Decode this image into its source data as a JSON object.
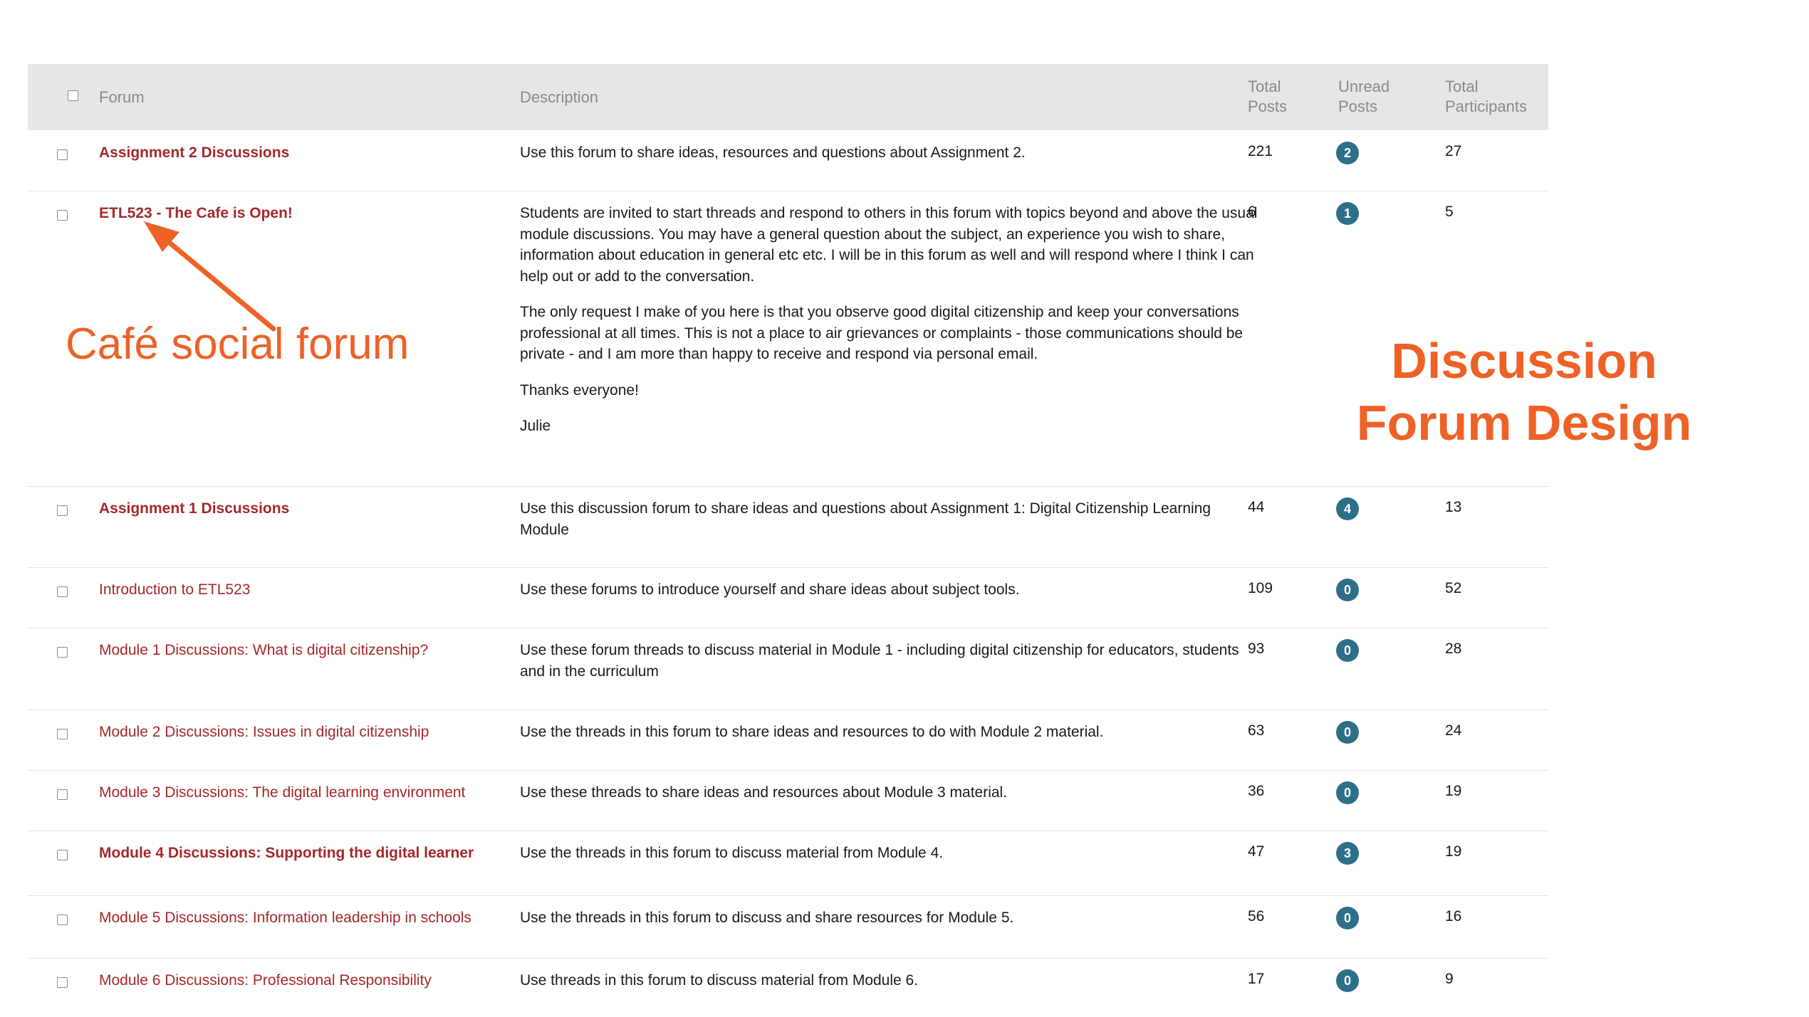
{
  "header": {
    "forum": "Forum",
    "description": "Description",
    "total_posts": "Total\nPosts",
    "unread_posts": "Unread\nPosts",
    "total_participants": "Total\nParticipants"
  },
  "rows": [
    {
      "forum": "Assignment 2 Discussions",
      "bold": true,
      "description": [
        "Use this forum to share ideas, resources and questions about Assignment 2."
      ],
      "total_posts": "221",
      "unread": "2",
      "participants": "27"
    },
    {
      "forum": "ETL523 - The Cafe is Open!",
      "bold": true,
      "description": [
        "Students are invited to start threads and respond to others in this forum with topics beyond and above the usual module discussions. You may have a general question about the subject, an experience you wish to share, information about education in general etc etc. I will be in this forum as well and will respond where I think I can help out or add to the conversation.",
        "The only request I make of you here is that you observe good digital citizenship and keep your conversations professional at all times. This is not a place to air grievances or complaints - those communications should be private - and I am more than happy to receive and respond via personal email.",
        "Thanks everyone!",
        "Julie"
      ],
      "total_posts": "6",
      "unread": "1",
      "participants": "5"
    },
    {
      "forum": "Assignment 1 Discussions",
      "bold": true,
      "description": [
        "Use this discussion forum to share ideas and questions about Assignment 1: Digital Citizenship Learning Module"
      ],
      "total_posts": "44",
      "unread": "4",
      "participants": "13"
    },
    {
      "forum": "Introduction to ETL523",
      "bold": false,
      "description": [
        "Use these forums to introduce yourself and share ideas about subject tools."
      ],
      "total_posts": "109",
      "unread": "0",
      "participants": "52"
    },
    {
      "forum": "Module 1 Discussions: What is digital citizenship?",
      "bold": false,
      "description": [
        "Use these forum threads to discuss material in Module 1 - including digital citizenship for educators, students and in the curriculum"
      ],
      "total_posts": "93",
      "unread": "0",
      "participants": "28"
    },
    {
      "forum": "Module 2 Discussions: Issues in digital citizenship",
      "bold": false,
      "description": [
        "Use the threads in this forum to share ideas and resources to do with Module 2 material."
      ],
      "total_posts": "63",
      "unread": "0",
      "participants": "24"
    },
    {
      "forum": "Module 3 Discussions: The digital learning environment",
      "bold": false,
      "description": [
        "Use these threads to share ideas and resources about Module 3 material."
      ],
      "total_posts": "36",
      "unread": "0",
      "participants": "19"
    },
    {
      "forum": "Module 4 Discussions: Supporting the digital learner",
      "bold": true,
      "description": [
        "Use the threads in this forum to discuss material from Module 4."
      ],
      "total_posts": "47",
      "unread": "3",
      "participants": "19"
    },
    {
      "forum": "Module 5 Discussions: Information leadership in schools",
      "bold": false,
      "description": [
        "Use the threads in this forum to discuss and share resources for Module 5."
      ],
      "total_posts": "56",
      "unread": "0",
      "participants": "16"
    },
    {
      "forum": "Module 6 Discussions: Professional Responsibility",
      "bold": false,
      "description": [
        "Use threads in this forum to discuss material from Module 6."
      ],
      "total_posts": "17",
      "unread": "0",
      "participants": "9"
    }
  ],
  "annotations": {
    "cafe_label": "Café social forum",
    "design_title": "Discussion\nForum Design",
    "accent_color": "#ee6227"
  },
  "colors": {
    "forum_link": "#a5282b",
    "badge": "#2d6f88",
    "header_bg": "#e6e6e6"
  }
}
